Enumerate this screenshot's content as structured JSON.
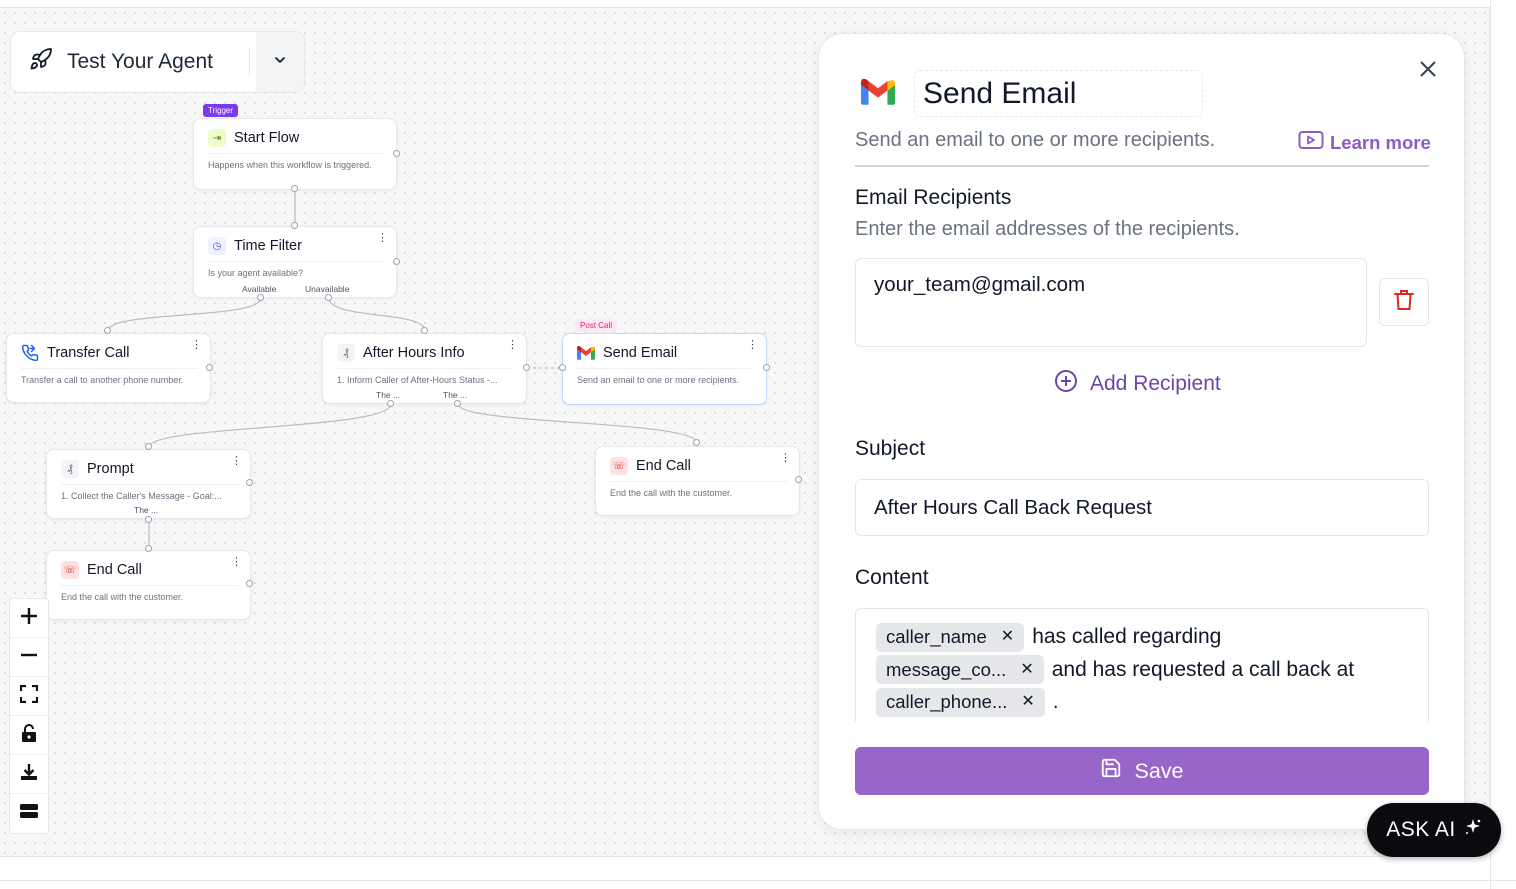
{
  "toolbar": {
    "test_agent_label": "Test Your Agent"
  },
  "nodes": {
    "start_flow": {
      "badge": "Trigger",
      "title": "Start Flow",
      "desc": "Happens when this workflow is triggered."
    },
    "time_filter": {
      "title": "Time Filter",
      "desc": "Is your agent available?",
      "handle_available": "Available",
      "handle_unavailable": "Unavailable"
    },
    "transfer_call": {
      "title": "Transfer Call",
      "desc": "Transfer a call to another phone number."
    },
    "after_hours": {
      "title": "After Hours Info",
      "desc": "1. Inform Caller of After-Hours Status -...",
      "handle_left": "The ...",
      "handle_right": "The ..."
    },
    "send_email": {
      "badge": "Post Call",
      "title": "Send Email",
      "desc": "Send an email to one or more recipients."
    },
    "prompt": {
      "title": "Prompt",
      "desc": "1. Collect the Caller's Message - Goal:...",
      "handle": "The ..."
    },
    "end_call_right": {
      "title": "End Call",
      "desc": "End the call with the customer."
    },
    "end_call_bottom": {
      "title": "End Call",
      "desc": "End the call with the customer."
    }
  },
  "panel": {
    "title": "Send Email",
    "subtitle": "Send an email to one or more recipients.",
    "learn_more": "Learn more",
    "recipients_label": "Email Recipients",
    "recipients_hint": "Enter the email addresses of the recipients.",
    "recipient_value": "your_team@gmail.com",
    "add_recipient": "Add Recipient",
    "subject_label": "Subject",
    "subject_value": "After Hours Call Back Request",
    "content_label": "Content",
    "content": {
      "chip1": "caller_name",
      "text1": "has called regarding",
      "chip2": "message_co...",
      "text2": "and has requested a call back at",
      "chip3": "caller_phone...",
      "text3": "."
    },
    "save_label": "Save"
  },
  "ask_ai": {
    "label": "ASK AI"
  },
  "colors": {
    "accent": "#9766c8",
    "accent_text": "#6b46a8",
    "trigger_badge": "#7c3aed",
    "post_call_badge_bg": "#fce7f3",
    "post_call_badge_text": "#db2777"
  }
}
